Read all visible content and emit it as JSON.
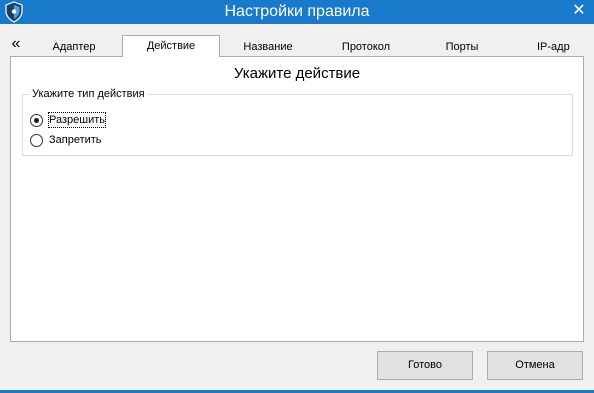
{
  "window": {
    "title": "Настройки правила",
    "close_glyph": "✕",
    "app_icon": "shield-icon",
    "accent_color": "#1979ca"
  },
  "tabs": {
    "scroll_left_glyph": "«",
    "items": [
      {
        "label": "Адаптер",
        "active": false
      },
      {
        "label": "Действие",
        "active": true
      },
      {
        "label": "Название",
        "active": false
      },
      {
        "label": "Протокол",
        "active": false
      },
      {
        "label": "Порты",
        "active": false
      },
      {
        "label": "IP-адр",
        "active": false
      }
    ]
  },
  "panel": {
    "heading": "Укажите действие",
    "group": {
      "legend": "Укажите тип действия",
      "options": [
        {
          "label": "Разрешить",
          "selected": true
        },
        {
          "label": "Запретить",
          "selected": false
        }
      ]
    }
  },
  "buttons": {
    "ok_label": "Готово",
    "cancel_label": "Отмена"
  }
}
